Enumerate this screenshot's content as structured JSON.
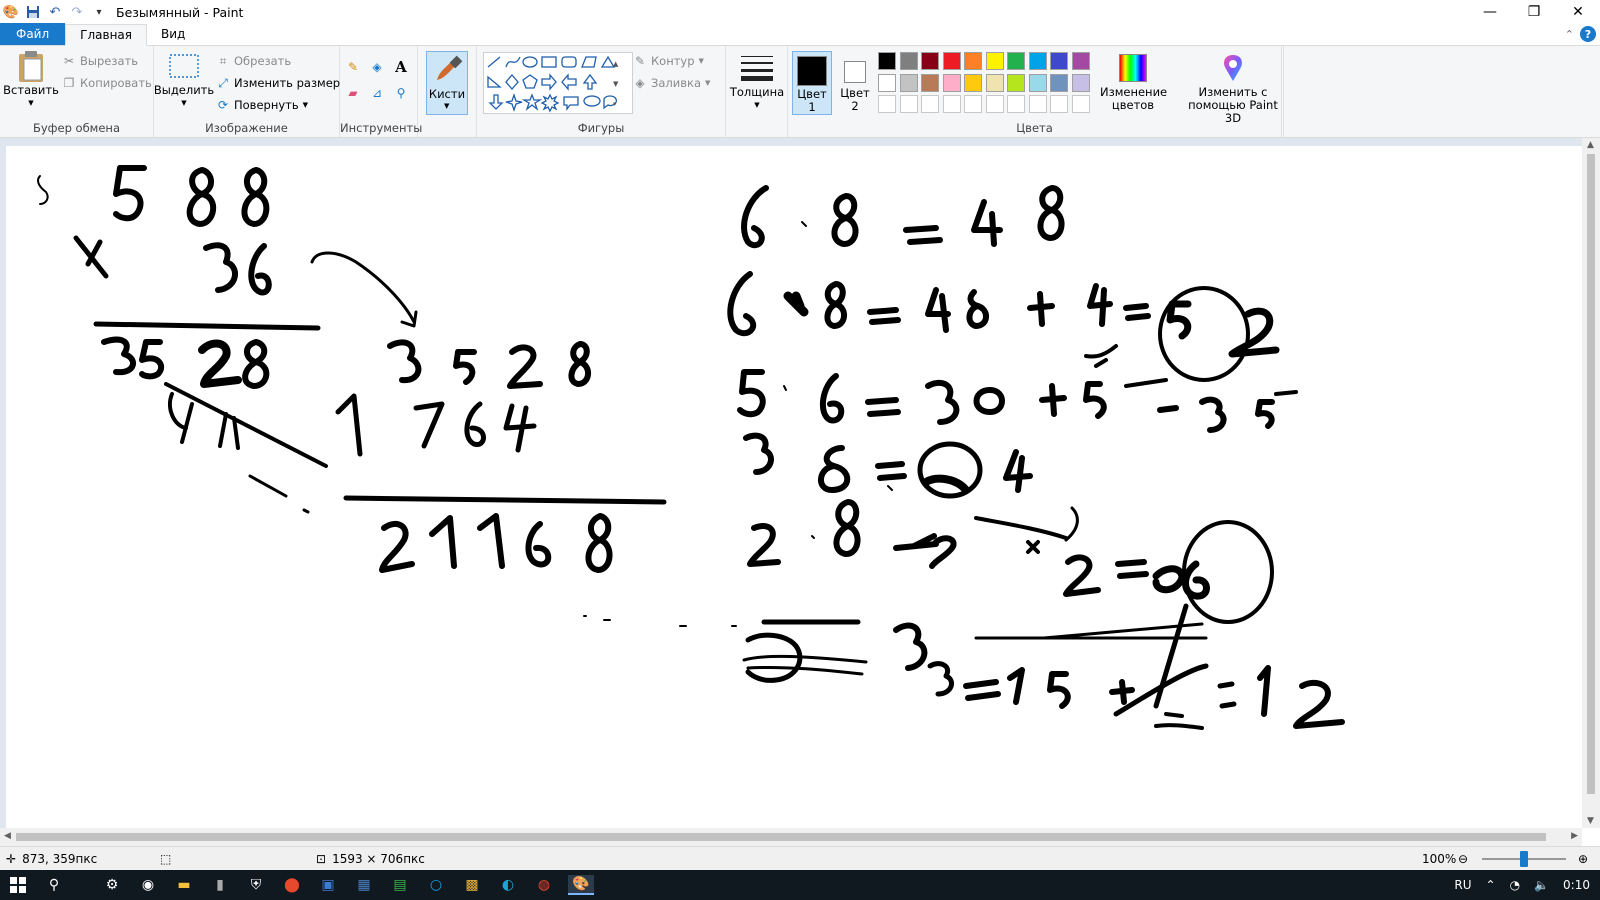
{
  "window": {
    "title": "Безымянный - Paint",
    "minimize": "—",
    "restore": "❐",
    "close": "✕"
  },
  "tabs": [
    {
      "label": "Файл"
    },
    {
      "label": "Главная"
    },
    {
      "label": "Вид"
    }
  ],
  "ribbon": {
    "clipboard": {
      "label": "Буфер обмена",
      "paste": "Вставить",
      "cut": "Вырезать",
      "copy": "Копировать"
    },
    "image": {
      "label": "Изображение",
      "select": "Выделить",
      "crop": "Обрезать",
      "resize": "Изменить размер",
      "rotate": "Повернуть"
    },
    "tools": {
      "label": "Инструменты"
    },
    "brushes": {
      "label": "Кисти"
    },
    "shapes": {
      "label": "Фигуры",
      "outline": "Контур",
      "fill": "Заливка"
    },
    "size": {
      "label": "Толщина"
    },
    "colors": {
      "label": "Цвета",
      "color1": "Цвет 1",
      "color2": "Цвет 2",
      "edit": "Изменение цветов",
      "color1_value": "#000000",
      "color2_value": "#ffffff",
      "palette": [
        "#000000",
        "#7f7f7f",
        "#880015",
        "#ed1c24",
        "#ff7f27",
        "#fff200",
        "#22b14c",
        "#00a2e8",
        "#3f48cc",
        "#a349a4",
        "#ffffff",
        "#c3c3c3",
        "#b97a57",
        "#ffaec9",
        "#ffc90e",
        "#efe4b0",
        "#b5e61d",
        "#99d9ea",
        "#7092be",
        "#c8bfe7"
      ]
    },
    "paint3d": {
      "label": "Изменить с помощью Paint 3D"
    }
  },
  "status": {
    "cursor": "873, 359пкс",
    "size": "1593 × 706пкс",
    "zoom": "100%",
    "zoom_level": 100
  },
  "taskbar": {
    "lang": "RU",
    "time": "0:10"
  }
}
